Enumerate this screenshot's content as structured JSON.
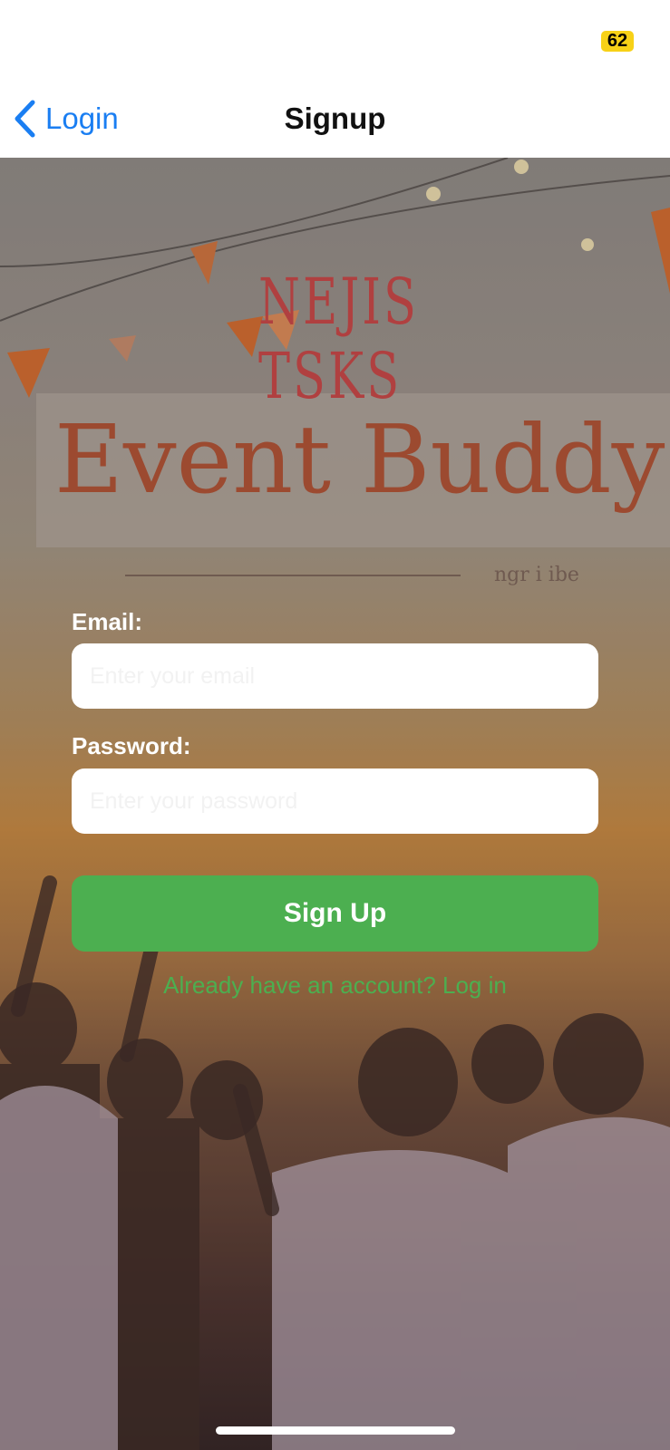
{
  "status_bar": {
    "battery_level": "62"
  },
  "nav": {
    "back_label": "Login",
    "title": "Signup"
  },
  "background": {
    "sign_top_text": "NEJIS TSKS",
    "sign_main_text": "Event Buddy",
    "sign_tagline": "ngr i ibe"
  },
  "form": {
    "email": {
      "label": "Email:",
      "placeholder": "Enter your email",
      "value": ""
    },
    "password": {
      "label": "Password:",
      "placeholder": "Enter your password",
      "value": ""
    },
    "submit_label": "Sign Up",
    "login_link": "Already have an account? Log in"
  },
  "colors": {
    "accent_blue": "#1a7ef2",
    "primary_green": "#4caf50",
    "battery_yellow": "#f7d117"
  }
}
